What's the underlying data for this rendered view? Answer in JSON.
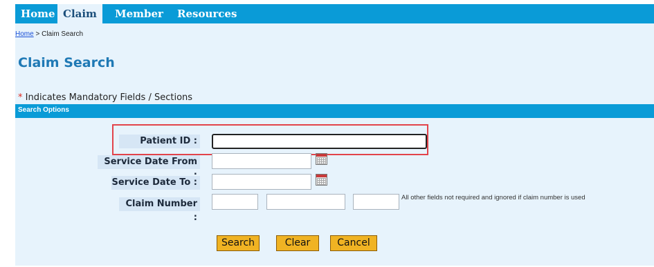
{
  "nav": {
    "tabs": [
      {
        "label": "Home",
        "active": false
      },
      {
        "label": "Claim",
        "active": true
      },
      {
        "label": "Member",
        "active": false
      },
      {
        "label": "Resources",
        "active": false
      }
    ]
  },
  "breadcrumb": {
    "home_link": "Home",
    "separator": " > ",
    "current": "Claim Search"
  },
  "page": {
    "title": "Claim Search",
    "mandatory_star": "*",
    "mandatory_text": " Indicates Mandatory Fields / Sections"
  },
  "section": {
    "title": "Search Options"
  },
  "form": {
    "patient_id_label": "Patient ID :",
    "service_date_from_label": "Service Date From :",
    "service_date_to_label": "Service Date To :",
    "claim_number_label": "Claim Number :",
    "claim_number_note": "All other fields not required and ignored if claim number is used"
  },
  "buttons": {
    "search": "Search",
    "clear": "Clear",
    "cancel": "Cancel"
  },
  "colors": {
    "nav": "#0a9bd7",
    "background": "#e7f3fc",
    "title": "#1f79b5",
    "button": "#f0b323",
    "highlight": "#e2434a"
  },
  "icons": {
    "calendar": "calendar-icon"
  }
}
